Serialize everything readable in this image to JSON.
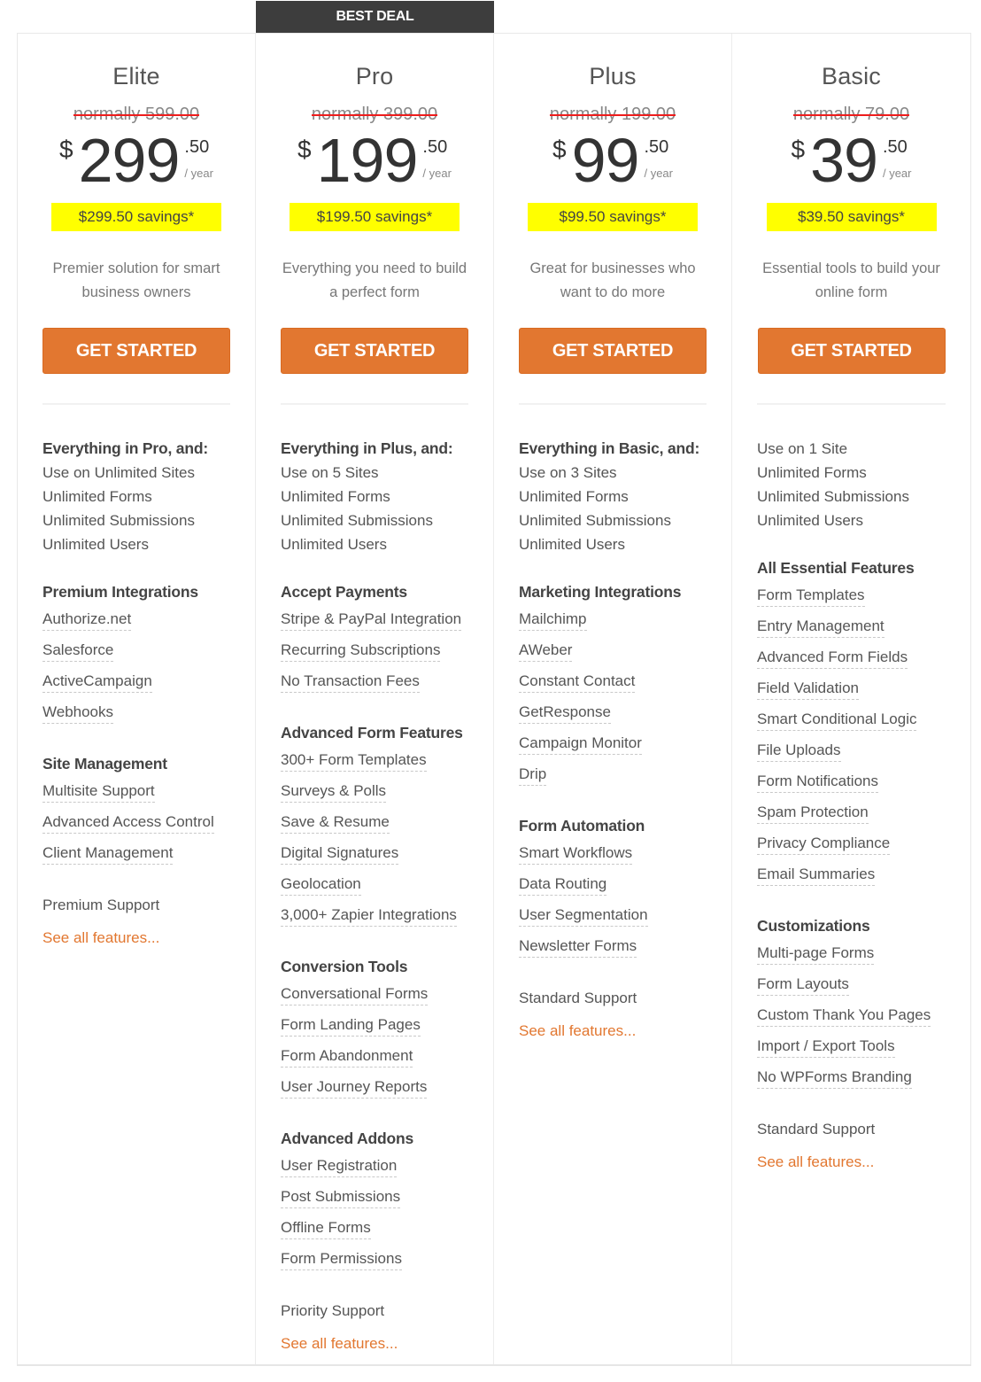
{
  "badge": "BEST DEAL",
  "colors": {
    "cta": "#e27730",
    "savings_highlight": "#ffff00",
    "badge_bg": "#3d3d3d",
    "strike": "#ee1c1c",
    "link": "#e27730"
  },
  "plans": [
    {
      "name": "Elite",
      "normal_price": "normally 599.00",
      "currency": "$",
      "price_whole": "299",
      "price_cents": ".50",
      "period": "/ year",
      "savings": "$299.50 savings*",
      "tagline": "Premier solution for smart business owners",
      "cta": "GET STARTED",
      "intro": {
        "title": "Everything in Pro, and:",
        "items": [
          "Use on Unlimited Sites",
          "Unlimited Forms",
          "Unlimited Submissions",
          "Unlimited Users"
        ]
      },
      "groups": [
        {
          "title": "Premium Integrations",
          "items": [
            "Authorize.net",
            "Salesforce",
            "ActiveCampaign",
            "Webhooks"
          ]
        },
        {
          "title": "Site Management",
          "items": [
            "Multisite Support",
            "Advanced Access Control",
            "Client Management"
          ]
        }
      ],
      "support": "Premium Support",
      "see_all": "See all features..."
    },
    {
      "name": "Pro",
      "normal_price": "normally 399.00",
      "currency": "$",
      "price_whole": "199",
      "price_cents": ".50",
      "period": "/ year",
      "savings": "$199.50 savings*",
      "tagline": "Everything you need to build a perfect form",
      "cta": "GET STARTED",
      "intro": {
        "title": "Everything in Plus, and:",
        "items": [
          "Use on 5 Sites",
          "Unlimited Forms",
          "Unlimited Submissions",
          "Unlimited Users"
        ]
      },
      "groups": [
        {
          "title": "Accept Payments",
          "items": [
            "Stripe & PayPal Integration",
            "Recurring Subscriptions",
            "No Transaction Fees"
          ]
        },
        {
          "title": "Advanced Form Features",
          "items": [
            "300+ Form Templates",
            "Surveys & Polls",
            "Save & Resume",
            "Digital Signatures",
            "Geolocation",
            "3,000+ Zapier Integrations"
          ]
        },
        {
          "title": "Conversion Tools",
          "items": [
            "Conversational Forms",
            "Form Landing Pages",
            "Form Abandonment",
            "User Journey Reports"
          ]
        },
        {
          "title": "Advanced Addons",
          "items": [
            "User Registration",
            "Post Submissions",
            "Offline Forms",
            "Form Permissions"
          ]
        }
      ],
      "support": "Priority Support",
      "see_all": "See all features..."
    },
    {
      "name": "Plus",
      "normal_price": "normally 199.00",
      "currency": "$",
      "price_whole": "99",
      "price_cents": ".50",
      "period": "/ year",
      "savings": "$99.50 savings*",
      "tagline": "Great for businesses who want to do more",
      "cta": "GET STARTED",
      "intro": {
        "title": "Everything in Basic, and:",
        "items": [
          "Use on 3 Sites",
          "Unlimited Forms",
          "Unlimited Submissions",
          "Unlimited Users"
        ]
      },
      "groups": [
        {
          "title": "Marketing Integrations",
          "items": [
            "Mailchimp",
            "AWeber",
            "Constant Contact",
            "GetResponse",
            "Campaign Monitor",
            "Drip"
          ]
        },
        {
          "title": "Form Automation",
          "items": [
            "Smart Workflows",
            "Data Routing",
            "User Segmentation",
            "Newsletter Forms"
          ]
        }
      ],
      "support": "Standard Support",
      "see_all": "See all features..."
    },
    {
      "name": "Basic",
      "normal_price": "normally 79.00",
      "currency": "$",
      "price_whole": "39",
      "price_cents": ".50",
      "period": "/ year",
      "savings": "$39.50 savings*",
      "tagline": "Essential tools to build your online form",
      "cta": "GET STARTED",
      "intro": {
        "title": "",
        "items": [
          "Use on 1 Site",
          "Unlimited Forms",
          "Unlimited Submissions",
          "Unlimited Users"
        ]
      },
      "groups": [
        {
          "title": "All Essential Features",
          "items": [
            "Form Templates",
            "Entry Management",
            "Advanced Form Fields",
            "Field Validation",
            "Smart Conditional Logic",
            "File Uploads",
            "Form Notifications",
            "Spam Protection",
            "Privacy Compliance",
            "Email Summaries"
          ]
        },
        {
          "title": "Customizations",
          "items": [
            "Multi-page Forms",
            "Form Layouts",
            "Custom Thank You Pages",
            "Import / Export Tools",
            "No WPForms Branding"
          ]
        }
      ],
      "support": "Standard Support",
      "see_all": "See all features..."
    }
  ]
}
